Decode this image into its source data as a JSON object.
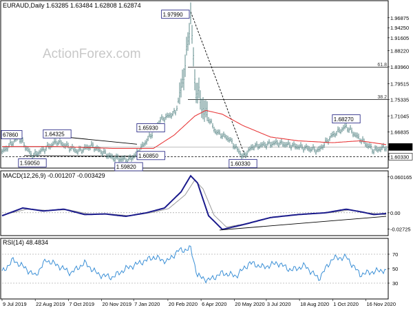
{
  "watermark": "ActionForex.com",
  "chart_data": [
    {
      "type": "line",
      "panel": "price",
      "header": "EURAUD,Daily  1.63285 1.63484 1.62808 1.62874",
      "ylim": [
        1.575,
        2.01
      ],
      "y_ticks": [
        "1.96875",
        "1.94250",
        "1.91605",
        "1.88220",
        "1.83960",
        "1.79515",
        "1.75335",
        "1.71045",
        "1.66835",
        "1.62874",
        "1.60330"
      ],
      "last_price": 1.62874,
      "price_anchors": [
        {
          "i": 0,
          "v": 1.615
        },
        {
          "i": 12,
          "v": 1.655
        },
        {
          "i": 22,
          "v": 1.605
        },
        {
          "i": 40,
          "v": 1.6432
        },
        {
          "i": 55,
          "v": 1.618
        },
        {
          "i": 65,
          "v": 1.632
        },
        {
          "i": 80,
          "v": 1.601
        },
        {
          "i": 92,
          "v": 1.595
        },
        {
          "i": 97,
          "v": 1.608
        },
        {
          "i": 108,
          "v": 1.6593
        },
        {
          "i": 115,
          "v": 1.7
        },
        {
          "i": 126,
          "v": 1.72
        },
        {
          "i": 130,
          "v": 1.78
        },
        {
          "i": 134,
          "v": 1.87
        },
        {
          "i": 137,
          "v": 1.9799
        },
        {
          "i": 140,
          "v": 1.8
        },
        {
          "i": 145,
          "v": 1.74
        },
        {
          "i": 155,
          "v": 1.67
        },
        {
          "i": 165,
          "v": 1.65
        },
        {
          "i": 175,
          "v": 1.6033
        },
        {
          "i": 182,
          "v": 1.63
        },
        {
          "i": 200,
          "v": 1.64
        },
        {
          "i": 215,
          "v": 1.63
        },
        {
          "i": 230,
          "v": 1.62
        },
        {
          "i": 240,
          "v": 1.66
        },
        {
          "i": 250,
          "v": 1.6827
        },
        {
          "i": 260,
          "v": 1.65
        },
        {
          "i": 270,
          "v": 1.62
        },
        {
          "i": 279,
          "v": 1.62874
        }
      ],
      "sma_anchors": [
        {
          "i": 0,
          "v": 1.63
        },
        {
          "i": 40,
          "v": 1.63
        },
        {
          "i": 80,
          "v": 1.625
        },
        {
          "i": 110,
          "v": 1.625
        },
        {
          "i": 125,
          "v": 1.66
        },
        {
          "i": 140,
          "v": 1.71
        },
        {
          "i": 148,
          "v": 1.725
        },
        {
          "i": 160,
          "v": 1.715
        },
        {
          "i": 175,
          "v": 1.685
        },
        {
          "i": 195,
          "v": 1.655
        },
        {
          "i": 215,
          "v": 1.645
        },
        {
          "i": 240,
          "v": 1.64
        },
        {
          "i": 260,
          "v": 1.645
        },
        {
          "i": 279,
          "v": 1.635
        }
      ],
      "annotations": [
        {
          "label": "1.97990",
          "i": 137,
          "v": 1.9799,
          "pos": "left"
        },
        {
          "label": "1.64325",
          "i": 40,
          "v": 1.6432,
          "pos": "above"
        },
        {
          "label": "1.59050",
          "i": 22,
          "v": 1.605,
          "pos": "below"
        },
        {
          "label": "1.59820",
          "i": 92,
          "v": 1.595,
          "pos": "below"
        },
        {
          "label": "1.60850",
          "i": 97,
          "v": 1.608,
          "pos": "right"
        },
        {
          "label": "1.65930",
          "i": 108,
          "v": 1.6593,
          "pos": "above"
        },
        {
          "label": "1.60330",
          "i": 175,
          "v": 1.6033,
          "pos": "below"
        },
        {
          "label": "1.68270",
          "i": 250,
          "v": 1.6827,
          "pos": "above"
        },
        {
          "label": "67860",
          "i": 4,
          "v": 1.663,
          "pos": "left"
        }
      ],
      "fib_levels": [
        {
          "name": "61.8",
          "value": 1.83889
        },
        {
          "name": "38.2",
          "value": 1.75335
        }
      ],
      "support_level": 1.6033
    },
    {
      "type": "line",
      "panel": "macd",
      "header": "MACD(12,26,9) -0.001207 -0.003429",
      "ylim": [
        -0.036,
        0.068
      ],
      "y_ticks": [
        "0.060165",
        "0.00",
        "-0.02725"
      ],
      "macd_anchors": [
        {
          "i": 0,
          "v": -0.005
        },
        {
          "i": 15,
          "v": 0.008
        },
        {
          "i": 30,
          "v": 0.003
        },
        {
          "i": 45,
          "v": 0.006
        },
        {
          "i": 60,
          "v": -0.003
        },
        {
          "i": 75,
          "v": -0.002
        },
        {
          "i": 90,
          "v": -0.006
        },
        {
          "i": 105,
          "v": 0.0
        },
        {
          "i": 118,
          "v": 0.008
        },
        {
          "i": 130,
          "v": 0.035
        },
        {
          "i": 137,
          "v": 0.062
        },
        {
          "i": 142,
          "v": 0.05
        },
        {
          "i": 150,
          "v": -0.005
        },
        {
          "i": 160,
          "v": -0.028
        },
        {
          "i": 175,
          "v": -0.02
        },
        {
          "i": 195,
          "v": -0.008
        },
        {
          "i": 215,
          "v": -0.003
        },
        {
          "i": 235,
          "v": 0.0
        },
        {
          "i": 250,
          "v": 0.006
        },
        {
          "i": 262,
          "v": 0.001
        },
        {
          "i": 270,
          "v": -0.003
        },
        {
          "i": 279,
          "v": -0.001207
        }
      ],
      "signal_anchors": [
        {
          "i": 0,
          "v": -0.004
        },
        {
          "i": 18,
          "v": 0.006
        },
        {
          "i": 33,
          "v": 0.004
        },
        {
          "i": 48,
          "v": 0.005
        },
        {
          "i": 63,
          "v": -0.002
        },
        {
          "i": 78,
          "v": -0.002
        },
        {
          "i": 93,
          "v": -0.005
        },
        {
          "i": 108,
          "v": 0.0
        },
        {
          "i": 121,
          "v": 0.007
        },
        {
          "i": 133,
          "v": 0.03
        },
        {
          "i": 140,
          "v": 0.055
        },
        {
          "i": 146,
          "v": 0.04
        },
        {
          "i": 154,
          "v": -0.004
        },
        {
          "i": 163,
          "v": -0.024
        },
        {
          "i": 178,
          "v": -0.018
        },
        {
          "i": 198,
          "v": -0.007
        },
        {
          "i": 218,
          "v": -0.003
        },
        {
          "i": 238,
          "v": 0.0
        },
        {
          "i": 253,
          "v": 0.005
        },
        {
          "i": 265,
          "v": 0.0
        },
        {
          "i": 279,
          "v": -0.003429
        }
      ]
    },
    {
      "type": "line",
      "panel": "rsi",
      "header": "RSI(14) 48.4834",
      "ylim": [
        10,
        90
      ],
      "y_ticks": [
        "70",
        "50",
        "30"
      ],
      "rsi_anchors": [
        {
          "i": 0,
          "v": 45
        },
        {
          "i": 8,
          "v": 62
        },
        {
          "i": 16,
          "v": 52
        },
        {
          "i": 24,
          "v": 40
        },
        {
          "i": 32,
          "v": 62
        },
        {
          "i": 40,
          "v": 55
        },
        {
          "i": 50,
          "v": 44
        },
        {
          "i": 60,
          "v": 58
        },
        {
          "i": 70,
          "v": 42
        },
        {
          "i": 80,
          "v": 38
        },
        {
          "i": 90,
          "v": 50
        },
        {
          "i": 100,
          "v": 58
        },
        {
          "i": 110,
          "v": 66
        },
        {
          "i": 120,
          "v": 60
        },
        {
          "i": 128,
          "v": 75
        },
        {
          "i": 133,
          "v": 76
        },
        {
          "i": 137,
          "v": 78
        },
        {
          "i": 142,
          "v": 40
        },
        {
          "i": 150,
          "v": 34
        },
        {
          "i": 160,
          "v": 44
        },
        {
          "i": 170,
          "v": 40
        },
        {
          "i": 180,
          "v": 58
        },
        {
          "i": 190,
          "v": 52
        },
        {
          "i": 200,
          "v": 58
        },
        {
          "i": 210,
          "v": 48
        },
        {
          "i": 220,
          "v": 54
        },
        {
          "i": 230,
          "v": 36
        },
        {
          "i": 240,
          "v": 64
        },
        {
          "i": 250,
          "v": 66
        },
        {
          "i": 260,
          "v": 42
        },
        {
          "i": 270,
          "v": 46
        },
        {
          "i": 279,
          "v": 48.4834
        }
      ]
    }
  ],
  "x_labels": [
    "9 Jul 2019",
    "22 Aug 2019",
    "7 Oct 2019",
    "20 Nov 2019",
    "7 Jan 2020",
    "20 Feb 2020",
    "6 Apr 2020",
    "20 May 2020",
    "3 Jul 2020",
    "18 Aug 2020",
    "1 Oct 2020",
    "16 Nov 2020"
  ],
  "x_label_index": [
    0,
    31,
    62,
    93,
    123,
    155,
    186,
    217,
    247,
    278,
    309,
    340
  ]
}
